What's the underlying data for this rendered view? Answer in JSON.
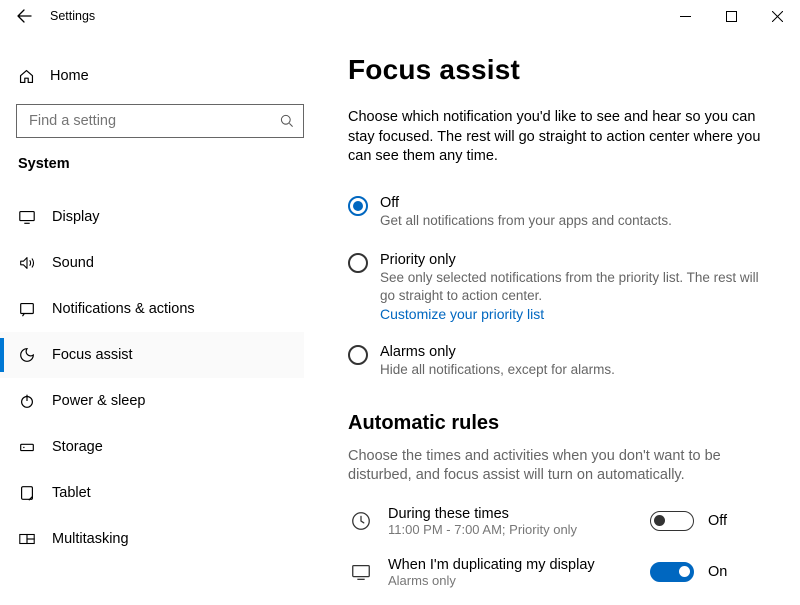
{
  "window": {
    "app_title": "Settings"
  },
  "sidebar": {
    "home_label": "Home",
    "search_placeholder": "Find a setting",
    "heading": "System",
    "items": [
      {
        "label": "Display"
      },
      {
        "label": "Sound"
      },
      {
        "label": "Notifications & actions"
      },
      {
        "label": "Focus assist"
      },
      {
        "label": "Power & sleep"
      },
      {
        "label": "Storage"
      },
      {
        "label": "Tablet"
      },
      {
        "label": "Multitasking"
      }
    ]
  },
  "page": {
    "title": "Focus assist",
    "lead": "Choose which notification you'd like to see and hear so you can stay focused. The rest will go straight to action center where you can see them any time.",
    "radios": [
      {
        "label": "Off",
        "desc": "Get all notifications from your apps and contacts."
      },
      {
        "label": "Priority only",
        "desc": "See only selected notifications from the priority list. The rest will go straight to action center.",
        "link": "Customize your priority list"
      },
      {
        "label": "Alarms only",
        "desc": "Hide all notifications, except for alarms."
      }
    ],
    "section_title": "Automatic rules",
    "section_lead": "Choose the times and activities when you don't want to be disturbed, and focus assist will turn on automatically.",
    "rules": [
      {
        "title": "During these times",
        "sub": "11:00 PM - 7:00 AM; Priority only",
        "state_label": "Off"
      },
      {
        "title": "When I'm duplicating my display",
        "sub": "Alarms only",
        "state_label": "On"
      }
    ]
  }
}
